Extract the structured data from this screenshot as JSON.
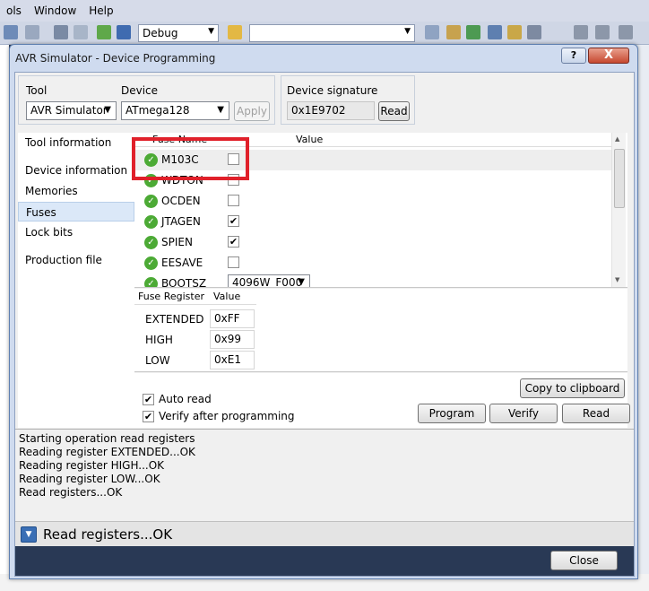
{
  "ide": {
    "menu": [
      "ols",
      "Window",
      "Help"
    ],
    "toolbar_config": "Debug"
  },
  "dialog": {
    "title": "AVR Simulator - Device Programming",
    "help_label": "?",
    "close_x": "X",
    "tool": {
      "label": "Tool",
      "value": "AVR Simulator"
    },
    "device": {
      "label": "Device",
      "value": "ATmega128",
      "apply_label": "Apply"
    },
    "signature": {
      "label": "Device signature",
      "value": "0x1E9702",
      "read_label": "Read"
    },
    "nav": [
      "Tool information",
      "Device information",
      "Memories",
      "Fuses",
      "Lock bits",
      "Production file"
    ],
    "nav_selected": "Fuses",
    "fuse_table": {
      "headers": [
        "Fuse Name",
        "Value"
      ],
      "rows": [
        {
          "name": "M103C",
          "checked": false
        },
        {
          "name": "WDTON",
          "checked": false
        },
        {
          "name": "OCDEN",
          "checked": false
        },
        {
          "name": "JTAGEN",
          "checked": true
        },
        {
          "name": "SPIEN",
          "checked": true
        },
        {
          "name": "EESAVE",
          "checked": false
        },
        {
          "name": "BOOTSZ",
          "select": "4096W_F000"
        }
      ]
    },
    "register_table": {
      "headers": [
        "Fuse Register",
        "Value"
      ],
      "rows": [
        {
          "name": "EXTENDED",
          "value": "0xFF"
        },
        {
          "name": "HIGH",
          "value": "0x99"
        },
        {
          "name": "LOW",
          "value": "0xE1"
        }
      ]
    },
    "options": {
      "auto_read": "Auto read",
      "verify_after": "Verify after programming",
      "copy_label": "Copy to clipboard",
      "program_label": "Program",
      "verify_label": "Verify",
      "read_label": "Read"
    },
    "log": [
      "Starting operation read registers",
      "Reading register EXTENDED...OK",
      "Reading register HIGH...OK",
      "Reading register LOW...OK",
      "Read registers...OK"
    ],
    "status": "Read registers...OK",
    "close_label": "Close"
  },
  "colors": {
    "highlight": "#e0202a",
    "ok": "#4caa35",
    "chrome": "#293955"
  }
}
